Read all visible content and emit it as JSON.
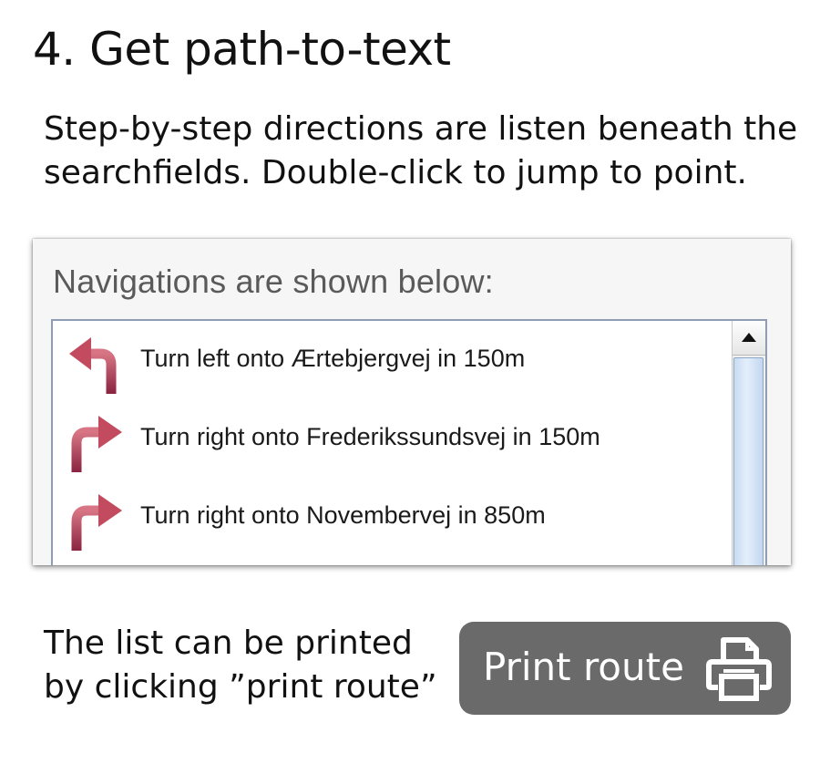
{
  "heading": "4. Get path-to-text",
  "intro": "Step-by-step directions are listen beneath the searchfields. Double-click to jump to point.",
  "panel": {
    "heading": "Navigations are shown below:",
    "directions": [
      {
        "icon": "turn-left-arrow-icon",
        "text": "Turn left onto Ærtebjergvej in 150m"
      },
      {
        "icon": "turn-right-arrow-icon",
        "text": "Turn right onto Frederikssundsvej in 150m"
      },
      {
        "icon": "turn-right-arrow-icon",
        "text": "Turn right onto Novembervej in 850m"
      }
    ]
  },
  "print_note": "The list can be printed by clicking ”print route”",
  "print_button": {
    "label": "Print route",
    "icon": "printer-icon"
  },
  "colors": {
    "arrow": "#a8344c",
    "button_bg": "#6a6a6a",
    "list_border": "#8f9db2",
    "scroll_thumb": "#cfe0f4"
  }
}
